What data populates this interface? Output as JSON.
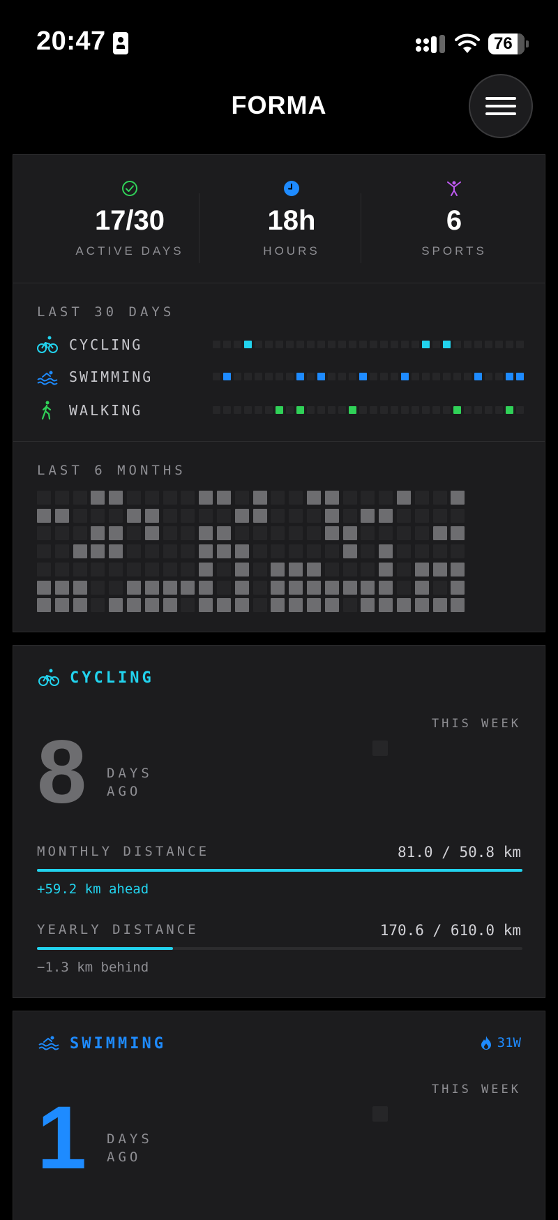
{
  "status_bar": {
    "time": "20:47",
    "battery": "76"
  },
  "header": {
    "title": "FORMA"
  },
  "summary": {
    "stats": [
      {
        "value": "17/30",
        "label": "ACTIVE DAYS",
        "icon": "check-circle-icon",
        "color": "#30d158"
      },
      {
        "value": "18h",
        "label": "HOURS",
        "icon": "clock-icon",
        "color": "#1e8bff"
      },
      {
        "value": "6",
        "label": "SPORTS",
        "icon": "person-icon",
        "color": "#bf5af2"
      }
    ],
    "last30": {
      "title": "LAST 30 DAYS",
      "rows": [
        {
          "label": "CYCLING",
          "icon": "bicycle-icon",
          "color": "#22d3ee",
          "active_days": [
            3,
            20,
            22
          ]
        },
        {
          "label": "SWIMMING",
          "icon": "swimming-icon",
          "color": "#1e8bff",
          "active_days": [
            1,
            8,
            10,
            14,
            18,
            25,
            28,
            29
          ]
        },
        {
          "label": "WALKING",
          "icon": "walking-icon",
          "color": "#30d158",
          "active_days": [
            6,
            8,
            13,
            23,
            28
          ]
        }
      ]
    },
    "last6months": {
      "title": "LAST 6 MONTHS",
      "grid": [
        "000110000110100110001001",
        "110001100001100010110000",
        "000110100110000011000011",
        "001110000111000001010000",
        "000000000101011100010111",
        "111001111101011111110101",
        "111011110111011110111111"
      ]
    }
  },
  "cycling": {
    "title": "CYCLING",
    "color": "#22d3ee",
    "days": "8",
    "days_label_1": "DAYS",
    "days_label_2": "AGO",
    "this_week": "THIS WEEK",
    "monthly": {
      "label": "MONTHLY DISTANCE",
      "value": "81.0 / 50.8 km",
      "progress": 1.0,
      "note": "+59.2 km ahead",
      "note_color": "#22d3ee"
    },
    "yearly": {
      "label": "YEARLY DISTANCE",
      "value": "170.6 / 610.0 km",
      "progress": 0.28,
      "note": "−1.3 km behind",
      "note_color": "#8e8e93"
    }
  },
  "swimming": {
    "title": "SWIMMING",
    "color": "#1e8bff",
    "streak": "31W",
    "days": "1",
    "days_label_1": "DAYS",
    "days_label_2": "AGO",
    "this_week": "THIS WEEK"
  }
}
